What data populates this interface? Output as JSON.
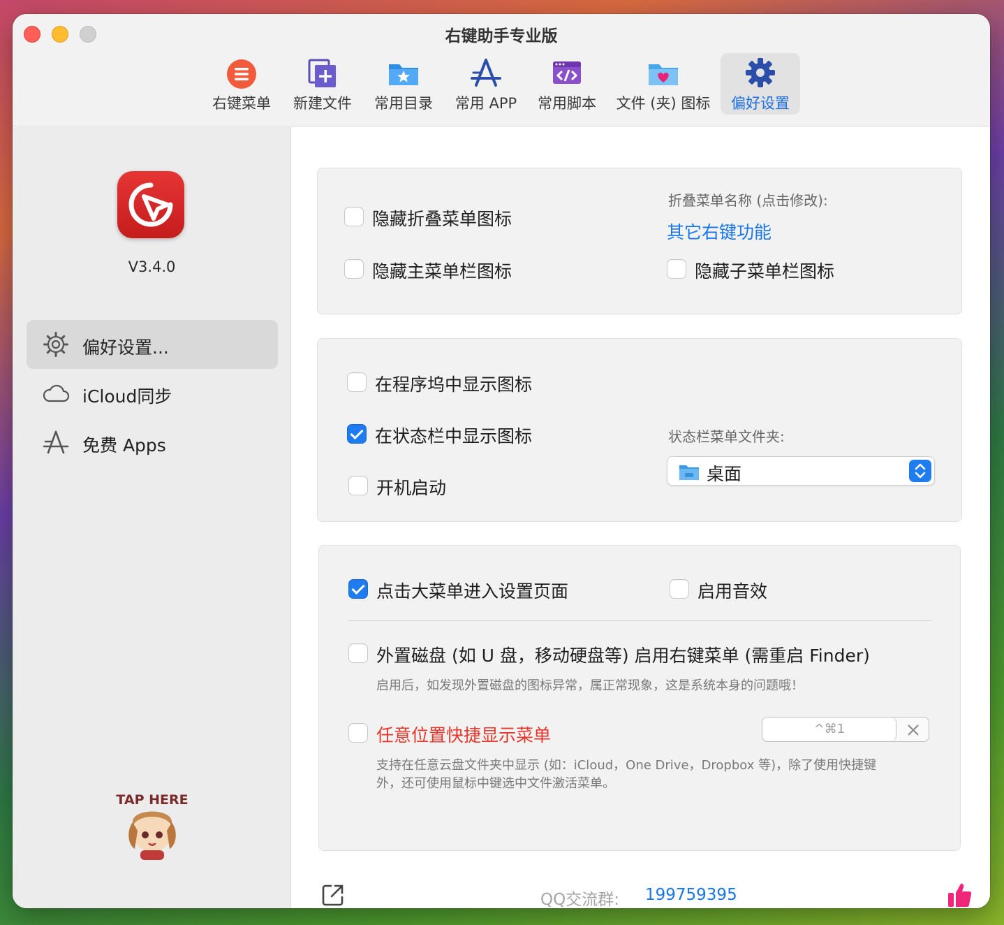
{
  "window": {
    "title": "右键助手专业版"
  },
  "toolbar": [
    {
      "label": "右键菜单",
      "icon": "list-circle-icon"
    },
    {
      "label": "新建文件",
      "icon": "new-file-icon"
    },
    {
      "label": "常用目录",
      "icon": "star-folder-icon"
    },
    {
      "label": "常用 APP",
      "icon": "app-store-icon"
    },
    {
      "label": "常用脚本",
      "icon": "script-icon"
    },
    {
      "label": "文件 (夹) 图标",
      "icon": "heart-folder-icon"
    },
    {
      "label": "偏好设置",
      "icon": "gear-icon",
      "active": true
    }
  ],
  "sidebar": {
    "version": "V3.4.0",
    "items": [
      {
        "label": "偏好设置...",
        "icon": "gear-icon",
        "active": true
      },
      {
        "label": "iCloud同步",
        "icon": "cloud-icon"
      },
      {
        "label": "免费 Apps",
        "icon": "app-store-icon"
      }
    ],
    "mascot_text": "TAP HERE"
  },
  "panel1": {
    "hide_fold_icon": {
      "label": "隐藏折叠菜单图标",
      "checked": false
    },
    "hide_main_icon": {
      "label": "隐藏主菜单栏图标",
      "checked": false
    },
    "fold_name_caption": "折叠菜单名称 (点击修改):",
    "fold_name_value": "其它右键功能",
    "hide_sub_icon": {
      "label": "隐藏子菜单栏图标",
      "checked": false
    }
  },
  "panel2": {
    "dock_icon": {
      "label": "在程序坞中显示图标",
      "checked": false
    },
    "statusbar_icon": {
      "label": "在状态栏中显示图标",
      "checked": true
    },
    "launch_at_login": {
      "label": "开机启动",
      "checked": false
    },
    "status_folder_caption": "状态栏菜单文件夹:",
    "status_folder_value": "桌面"
  },
  "panel3": {
    "big_menu_settings": {
      "label": "点击大菜单进入设置页面",
      "checked": true
    },
    "sound": {
      "label": "启用音效",
      "checked": false
    },
    "external_disk": {
      "label": "外置磁盘 (如 U 盘，移动硬盘等) 启用右键菜单 (需重启 Finder)",
      "checked": false
    },
    "external_disk_note": "启用后，如发现外置磁盘的图标异常，属正常现象，这是系统本身的问题哦！",
    "quick_menu": {
      "label": "任意位置快捷显示菜单",
      "checked": false
    },
    "shortcut": "^⌘1",
    "quick_menu_note_1": "支持在任意云盘文件夹中显示 (如：iCloud，One Drive，Dropbox 等)，除了使用快捷键",
    "quick_menu_note_2": "外，还可使用鼠标中键选中文件激活菜单。"
  },
  "footer": {
    "qq_caption": "QQ交流群:",
    "qq_number": "199759395"
  },
  "colors": {
    "accent": "#1f7cf0",
    "link": "#1876e6",
    "warning": "#e8362b",
    "app_icon": "#d62424",
    "thumb": "#f0267a"
  }
}
